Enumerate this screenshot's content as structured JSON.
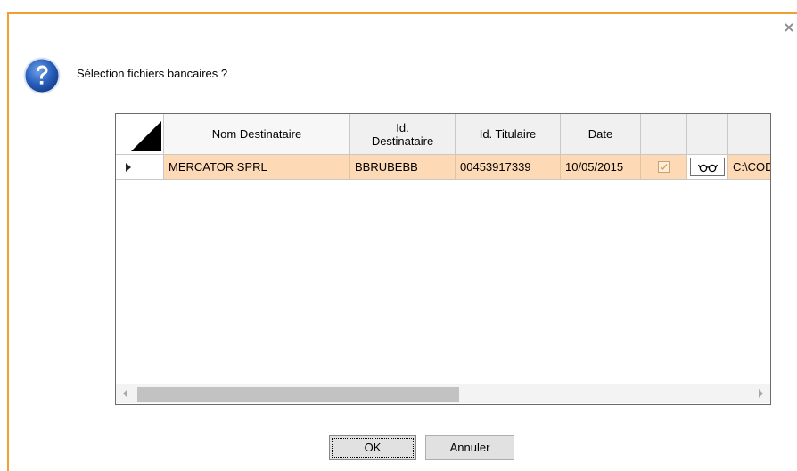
{
  "dialog": {
    "prompt": "Sélection fichiers bancaires ?",
    "close_icon": "×"
  },
  "grid": {
    "columns": [
      {
        "label": "Nom Destinataire"
      },
      {
        "label": "Id.\nDestinataire"
      },
      {
        "label": "Id. Titulaire"
      },
      {
        "label": "Date"
      },
      {
        "label": ""
      },
      {
        "label": ""
      },
      {
        "label": ""
      }
    ],
    "rows": [
      {
        "nom_destinataire": "MERCATOR SPRL",
        "id_destinataire": "BBRUBEBB",
        "id_titulaire": "00453917339",
        "date": "10/05/2015",
        "selected": true,
        "path": "C:\\COD"
      }
    ]
  },
  "buttons": {
    "ok": "OK",
    "cancel": "Annuler"
  },
  "icons": {
    "question": "question-icon",
    "view": "glasses-icon"
  },
  "colors": {
    "selected_row": "#fdd9b5",
    "window_border": "#f0a030",
    "question_icon": "#1f58b4"
  }
}
